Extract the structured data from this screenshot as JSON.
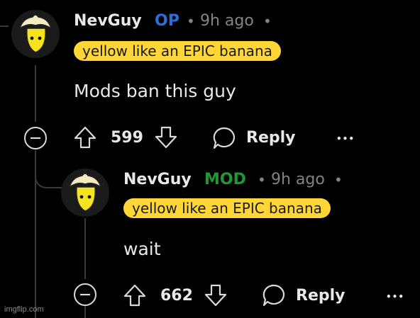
{
  "comments": [
    {
      "username": "NevGuy",
      "role": "OP",
      "separator": "•",
      "time": "9h ago",
      "flair": "yellow like an EPIC banana",
      "body": "Mods ban this guy",
      "votes": "599",
      "reply_label": "Reply",
      "more_label": "•••",
      "role_color": "#2a6fdb"
    },
    {
      "username": "NevGuy",
      "role": "MOD",
      "separator": "•",
      "time": "9h ago",
      "flair": "yellow like an EPIC banana",
      "body": "wait",
      "votes": "662",
      "reply_label": "Reply",
      "more_label": "•••",
      "role_color": "#1f9a33"
    }
  ],
  "watermark": "imgflip.com",
  "icons": {
    "avatar": "banana-avatar-icon",
    "collapse": "collapse-minus-icon",
    "upvote": "upvote-arrow-icon",
    "downvote": "downvote-arrow-icon",
    "reply": "speech-bubble-icon"
  },
  "colors": {
    "background": "#000000",
    "flair_bg": "#ffd635",
    "meta_gray": "#818384"
  }
}
